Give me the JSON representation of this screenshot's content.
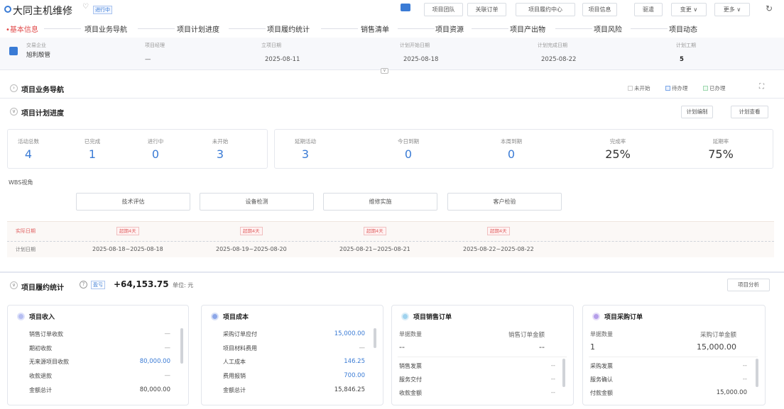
{
  "header": {
    "title": "大同主机维修",
    "status": "进行中",
    "buttons": [
      "项目团队",
      "关联订单",
      "项目履约中心",
      "项目信息",
      "驱遣",
      "变更",
      "更多"
    ]
  },
  "tabs": [
    "•基本信息",
    "项目业务导航",
    "项目计划进度",
    "项目履约统计",
    "销售清单",
    "项目资源",
    "项目产出物",
    "项目风险",
    "项目动态"
  ],
  "info": {
    "fields": [
      {
        "label": "交易企业",
        "value": "旭利殷管"
      },
      {
        "label": "项目经理",
        "value": "—"
      },
      {
        "label": "立项日期",
        "value": "2025-08-11"
      },
      {
        "label": "计划开始日期",
        "value": "2025-08-18"
      },
      {
        "label": "计划完成日期",
        "value": "2025-08-22"
      },
      {
        "label": "计划工期",
        "value": "5"
      }
    ]
  },
  "nav": {
    "title": "项目业务导航",
    "legend": [
      "未开始",
      "待办理",
      "已办理"
    ]
  },
  "plan": {
    "title": "项目计划进度",
    "buttons": [
      "计划编制",
      "计划查看"
    ],
    "stats": [
      {
        "label": "活动总数",
        "value": "4"
      },
      {
        "label": "已完成",
        "value": "1"
      },
      {
        "label": "进行中",
        "value": "0"
      },
      {
        "label": "未开始",
        "value": "3"
      },
      {
        "label": "延期活动",
        "value": "3"
      },
      {
        "label": "今日到期",
        "value": "0"
      },
      {
        "label": "本周到期",
        "value": "0"
      },
      {
        "label": "完成率",
        "value": "25%"
      },
      {
        "label": "延期率",
        "value": "75%"
      }
    ],
    "wbs_label": "WBS视角",
    "wbs": [
      "技术评估",
      "设备检测",
      "维修实施",
      "客户检验"
    ],
    "actual_label": "实际日期",
    "plan_label": "计划日期",
    "badge": "超期4天",
    "dates": [
      "2025-08-18~2025-08-18",
      "2025-08-19~2025-08-20",
      "2025-08-21~2025-08-21",
      "2025-08-22~2025-08-22"
    ]
  },
  "stats": {
    "title": "项目履约统计",
    "profit_label": "盈亏",
    "profit": "+64,153.75",
    "unit": "单位: 元",
    "btn": "项目分析"
  },
  "cards": [
    {
      "title": "项目收入",
      "color": "#b6bef2",
      "rows": [
        [
          "销售订单收款",
          "—"
        ],
        [
          "期初收款",
          "—"
        ],
        [
          "无来源项目收款",
          "80,000.00"
        ],
        [
          "收款退款",
          "—"
        ],
        [
          "金额总计",
          "80,000.00"
        ]
      ]
    },
    {
      "title": "项目成本",
      "color": "#8ba6e8",
      "rows": [
        [
          "采购订单应付",
          "15,000.00"
        ],
        [
          "项目材料费用",
          "—"
        ],
        [
          "人工成本",
          "146.25"
        ],
        [
          "费用报销",
          "700.00"
        ],
        [
          "金额总计",
          "15,846.25"
        ]
      ]
    },
    {
      "title": "项目销售订单",
      "color": "#9fd2ee",
      "top": [
        "单据数量",
        "销售订单金额"
      ],
      "topv": [
        "--",
        "--"
      ],
      "rows": [
        [
          "销售发票",
          "--"
        ],
        [
          "服务交付",
          "--"
        ],
        [
          "收款金额",
          "--"
        ]
      ]
    },
    {
      "title": "项目采购订单",
      "color": "#b59ee9",
      "top": [
        "单据数量",
        "采购订单金额"
      ],
      "topv": [
        "1",
        "15,000.00"
      ],
      "rows": [
        [
          "采购发票",
          "--"
        ],
        [
          "服务确认",
          "--"
        ],
        [
          "付款金额",
          "15,000.00"
        ]
      ]
    }
  ]
}
